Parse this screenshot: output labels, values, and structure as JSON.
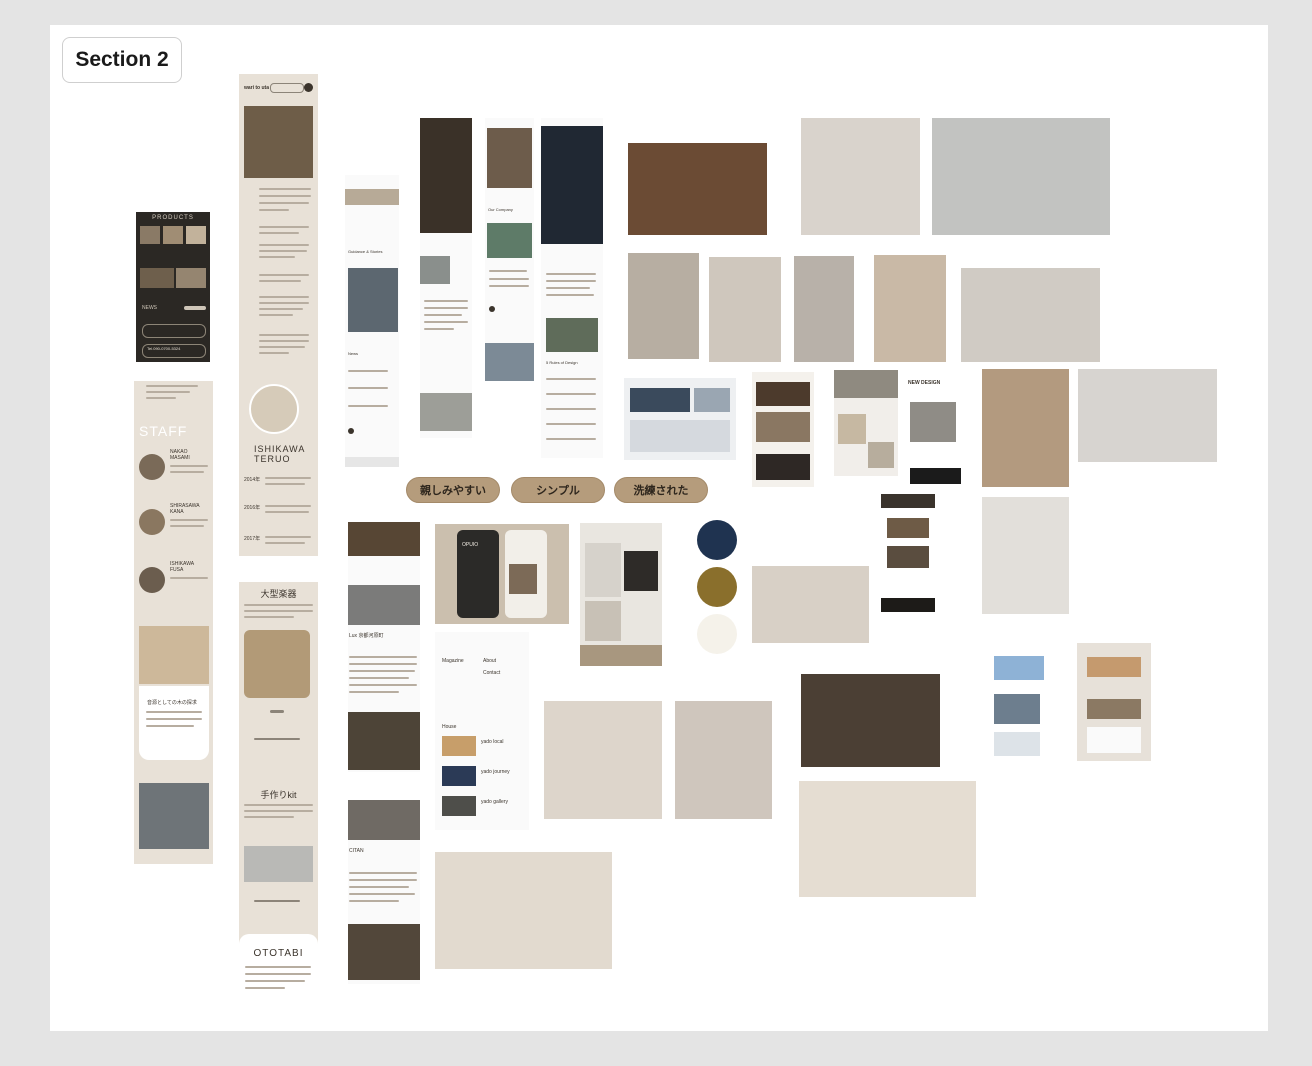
{
  "section": {
    "label": "Section 2"
  },
  "keywords": [
    "親しみやすい",
    "シンプル",
    "洗練された"
  ],
  "palette": {
    "navy": "#1f3350",
    "olive": "#8a6f2c",
    "cream": "#f5f2ea"
  },
  "ref_a": {
    "products": "PRODUCTS",
    "news": "NEWS",
    "staff": "STAFF",
    "tel": "Tel.090-0700-5324",
    "staff_1": "NAKAO\nMASAMI",
    "staff_2": "SHIRASAWA\nKANA",
    "staff_3": "ISHIKAWA\nFUSA",
    "card_title": "音源としての木の探求"
  },
  "ref_b": {
    "logo": "wari to uta",
    "name": "ISHIKAWA\nTERUO",
    "y1": "2014年",
    "y2": "2016年",
    "y3": "2017年",
    "section_1": "大型楽器",
    "section_2": "手作りkit",
    "section_3": "OTOTABI"
  },
  "ref_c": {
    "company": "Our Company",
    "rules": "5 Rules of Design",
    "heading": "Guidance & Stories",
    "news": "News"
  },
  "ref_d": {
    "app": "OPUIO",
    "mag": "Magazine",
    "about": "About",
    "contact": "Contact",
    "house": "House",
    "villa_1": "yado local",
    "villa_2": "yado journey",
    "villa_3": "yado gallery",
    "cafe_1": "Lux 京都河原町",
    "cafe_2": "CITAN",
    "new_design": "NEW DESIGN"
  }
}
